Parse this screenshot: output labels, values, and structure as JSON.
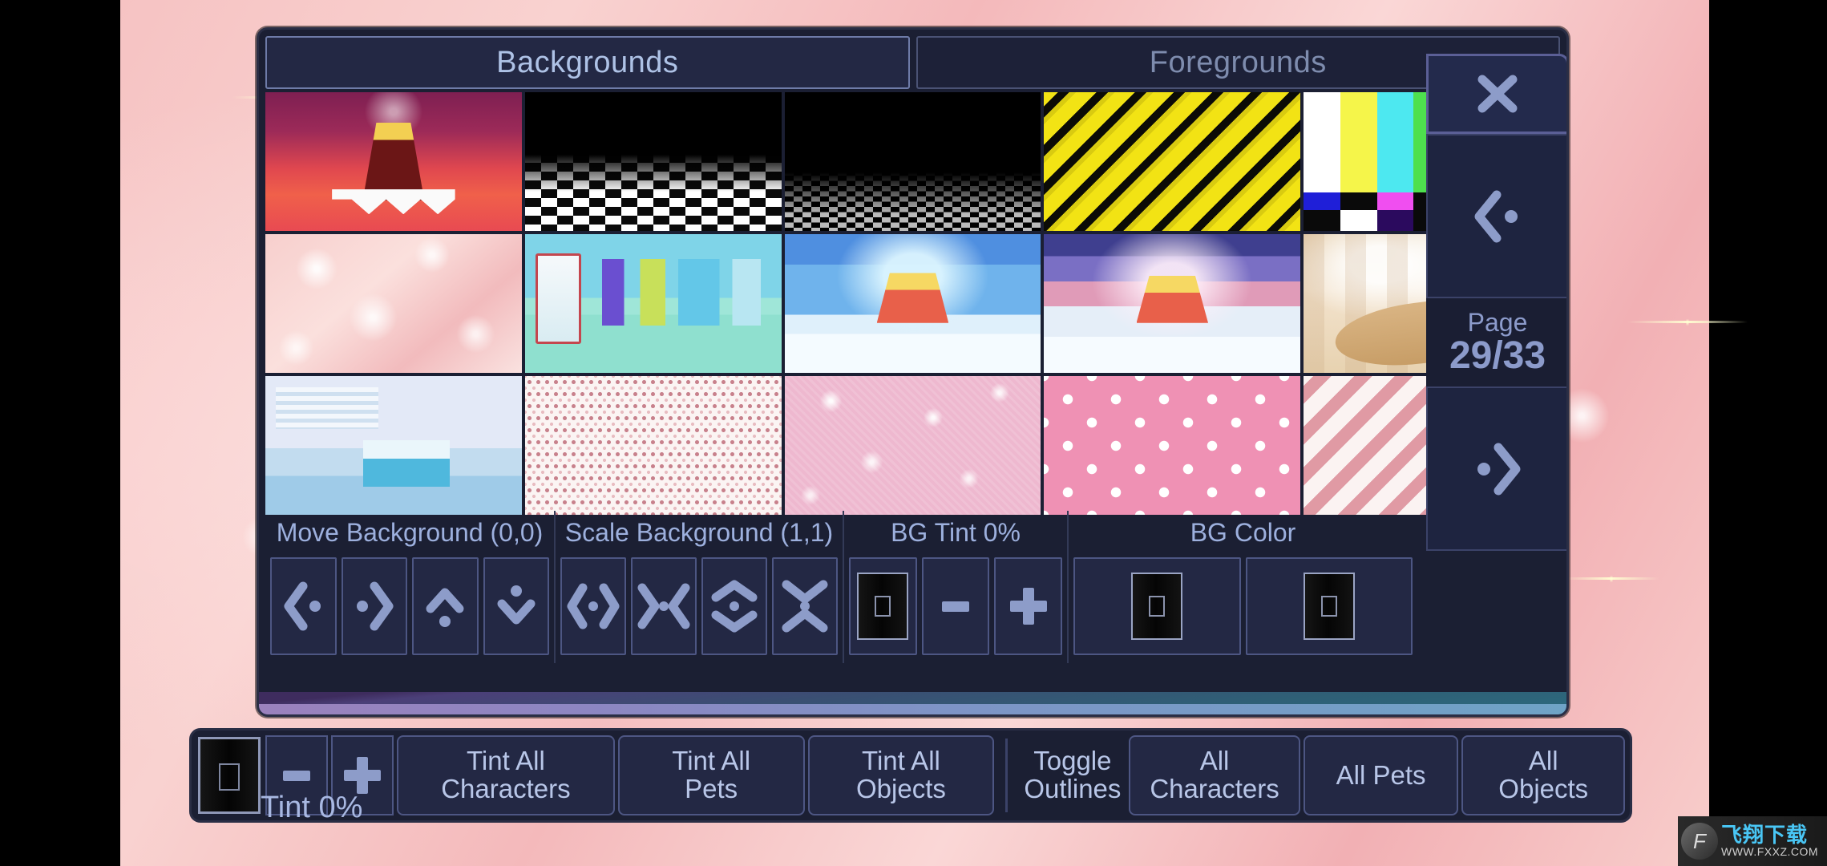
{
  "tabs": [
    {
      "label": "Backgrounds",
      "active": true
    },
    {
      "label": "Foregrounds",
      "active": false
    }
  ],
  "sidebar": {
    "close_label": "X",
    "prev_icon": "chevron-left-dot-icon",
    "next_icon": "dot-chevron-right-icon",
    "page_word": "Page",
    "page_value": "29/33"
  },
  "grid": {
    "rows": 3,
    "cols": 5,
    "selected_index": 5,
    "items": [
      {
        "name": "circus-stage-thumbnail",
        "art": "t-stage"
      },
      {
        "name": "checkerboard-floor-thumbnail",
        "art": "t-checker-light"
      },
      {
        "name": "dark-checkerboard-thumbnail",
        "art": "t-checker-dark"
      },
      {
        "name": "hazard-stripes-thumbnail",
        "art": "t-hazard"
      },
      {
        "name": "tv-color-bars-thumbnail",
        "art": "t-bars"
      },
      {
        "name": "pink-sparkle-thumbnail",
        "art": "t-pinksparkle"
      },
      {
        "name": "clothing-store-thumbnail",
        "art": "t-store"
      },
      {
        "name": "blue-throne-room-thumbnail",
        "art": "t-throne-blue"
      },
      {
        "name": "pink-throne-room-thumbnail",
        "art": "t-throne-pink"
      },
      {
        "name": "cathedral-boat-thumbnail",
        "art": "t-cathedral"
      },
      {
        "name": "office-lab-thumbnail",
        "art": "t-office"
      },
      {
        "name": "white-pink-dots-thumbnail",
        "art": "t-dots-white"
      },
      {
        "name": "pink-glitter-thumbnail",
        "art": "t-pinkglitter"
      },
      {
        "name": "pink-polka-dots-thumbnail",
        "art": "t-dots-pink"
      },
      {
        "name": "pink-diagonal-stripes-thumbnail",
        "art": "t-stripes-pink"
      }
    ],
    "color_bars": {
      "top": [
        "#ffffff",
        "#f5f54a",
        "#4de8f0",
        "#4ee04e",
        "#f04ef0",
        "#ef3b22",
        "#1f1fd8"
      ],
      "bottom": [
        "#1f1fd8",
        "#0a0a0a",
        "#f04ef0",
        "#0a0a0a",
        "#4de8f0",
        "#0a0a0a",
        "#ffffff"
      ],
      "strip": [
        "#0a0a0a",
        "#ffffff",
        "#2b0a5e",
        "#0a0a0a",
        "#0a0a0a",
        "#0a0a0a",
        "#0a0a0a"
      ]
    }
  },
  "bg_controls": {
    "groups": [
      {
        "title": "Move Background (0,0)",
        "buttons": [
          {
            "name": "move-bg-left-button",
            "icon": "chevron-left-dot-icon"
          },
          {
            "name": "move-bg-right-button",
            "icon": "dot-chevron-right-icon"
          },
          {
            "name": "move-bg-up-button",
            "icon": "chevron-up-dot-icon"
          },
          {
            "name": "move-bg-down-button",
            "icon": "dot-chevron-down-icon"
          }
        ]
      },
      {
        "title": "Scale Background (1,1)",
        "buttons": [
          {
            "name": "scale-bg-wider-button",
            "icon": "expand-horizontal-icon"
          },
          {
            "name": "scale-bg-narrower-button",
            "icon": "collapse-horizontal-icon"
          },
          {
            "name": "scale-bg-taller-button",
            "icon": "expand-vertical-icon"
          },
          {
            "name": "scale-bg-shorter-button",
            "icon": "collapse-vertical-icon"
          }
        ]
      },
      {
        "title": "BG Tint 0%",
        "buttons": [
          {
            "name": "bg-tint-swatch",
            "icon": "color-swatch-icon"
          },
          {
            "name": "bg-tint-minus-button",
            "icon": "minus-icon"
          },
          {
            "name": "bg-tint-plus-button",
            "icon": "plus-icon"
          }
        ]
      },
      {
        "title": "BG Color",
        "buttons": [
          {
            "name": "bg-color-swatch-1",
            "icon": "color-swatch-icon"
          },
          {
            "name": "bg-color-swatch-2",
            "icon": "color-swatch-icon"
          }
        ]
      }
    ]
  },
  "bottom_bar": {
    "tint_label": "Tint 0%",
    "swatch_name": "global-tint-swatch",
    "minus_label": "-",
    "plus_label": "+",
    "buttons": [
      {
        "name": "tint-all-characters-button",
        "label": "Tint All\nCharacters"
      },
      {
        "name": "tint-all-pets-button",
        "label": "Tint All\nPets"
      },
      {
        "name": "tint-all-objects-button",
        "label": "Tint All\nObjects"
      }
    ],
    "toggle_outlines_label": "Toggle\nOutlines",
    "outline_buttons": [
      {
        "name": "outlines-all-characters-button",
        "label": "All\nCharacters"
      },
      {
        "name": "outlines-all-pets-button",
        "label": "All Pets"
      },
      {
        "name": "outlines-all-objects-button",
        "label": "All\nObjects"
      }
    ]
  },
  "watermark": {
    "logo_glyph": "F",
    "title": "飞翔下载",
    "url": "WWW.FXXZ.COM"
  },
  "colors": {
    "panel_bg": "#1b1f33",
    "button_bg": "#232844",
    "button_border": "#4d5683",
    "text": "#b8c6e8",
    "accent": "#8d9cc9",
    "tab_active_border": "#6e7ba8"
  }
}
